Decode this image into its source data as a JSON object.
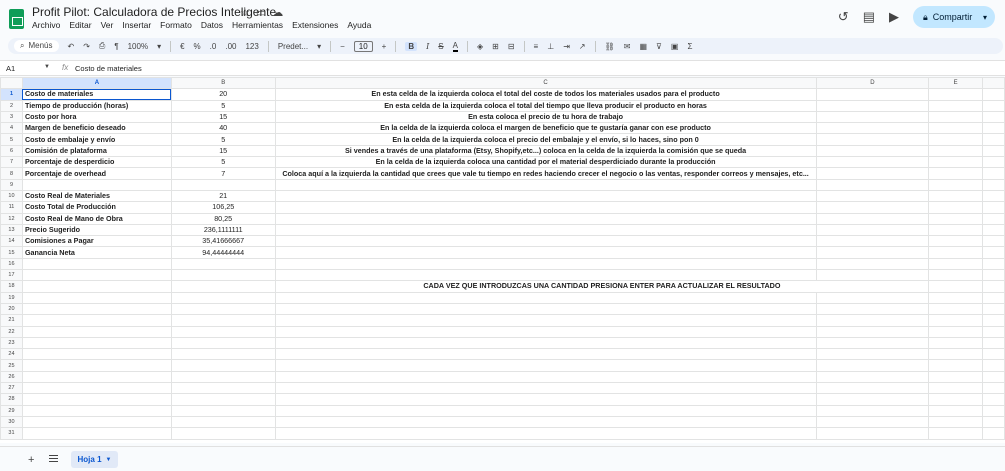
{
  "app": {
    "title": "Profit Pilot: Calculadora de Precios Inteligente",
    "share_label": "Compartir"
  },
  "menu": [
    "Archivo",
    "Editar",
    "Ver",
    "Insertar",
    "Formato",
    "Datos",
    "Herramientas",
    "Extensiones",
    "Ayuda"
  ],
  "toolbar": {
    "search_label": "Menús",
    "zoom": "100%",
    "currency": "€",
    "percent": "%",
    "dec_less": ".0",
    "dec_more": ".00",
    "number_format": "123",
    "font": "Predet...",
    "font_size": "10",
    "bold": "B",
    "italic": "I",
    "strike": "S",
    "text_color": "A",
    "sigma": "Σ"
  },
  "formula_bar": {
    "cell_ref": "A1",
    "fx": "fx",
    "content": "Costo de materiales"
  },
  "columns": [
    "A",
    "B",
    "C",
    "D",
    "E"
  ],
  "rows": [
    {
      "n": "1",
      "a": "Costo de materiales",
      "b": "20",
      "c": "En esta celda de la izquierda coloca el total del coste de todos los materiales usados para el producto"
    },
    {
      "n": "2",
      "a": "Tiempo de producción (horas)",
      "b": "5",
      "c": "En esta celda de la izquierda coloca el total del tiempo que lleva producir el producto en horas"
    },
    {
      "n": "3",
      "a": "Costo por hora",
      "b": "15",
      "c": "En esta coloca el precio de tu hora de trabajo"
    },
    {
      "n": "4",
      "a": "Margen de beneficio deseado",
      "b": "40",
      "c": "En la celda de la izquierda coloca el margen de beneficio que te gustaría ganar con ese producto"
    },
    {
      "n": "5",
      "a": "Costo de embalaje y envío",
      "b": "5",
      "c": "En la celda de la izquierda coloca el precio del embalaje y el envío, si lo haces, sino pon 0"
    },
    {
      "n": "6",
      "a": "Comisión de plataforma",
      "b": "15",
      "c": "Si vendes a través de una plataforma (Etsy, Shopify,etc...) coloca en la celda de la izquierda la comisión que se queda"
    },
    {
      "n": "7",
      "a": "Porcentaje de desperdicio",
      "b": "5",
      "c": "En la celda de la izquierda coloca una cantidad por el material desperdiciado durante la producción"
    },
    {
      "n": "8",
      "a": "Porcentaje de overhead",
      "b": "7",
      "c": "Coloca aquí a la izquierda la cantidad que crees que vale tu tiempo en redes haciendo crecer el negocio o las ventas, responder correos y mensajes, etc..."
    },
    {
      "n": "9",
      "a": "",
      "b": "",
      "c": ""
    },
    {
      "n": "10",
      "a": "Costo Real de Materiales",
      "b": "21",
      "c": ""
    },
    {
      "n": "11",
      "a": "Costo Total de Producción",
      "b": "106,25",
      "c": ""
    },
    {
      "n": "12",
      "a": "Costo Real de Mano de Obra",
      "b": "80,25",
      "c": ""
    },
    {
      "n": "13",
      "a": "Precio Sugerido",
      "b": "236,1111111",
      "c": ""
    },
    {
      "n": "14",
      "a": "Comisiones a Pagar",
      "b": "35,41666667",
      "c": ""
    },
    {
      "n": "15",
      "a": "Ganancia Neta",
      "b": "94,44444444",
      "c": ""
    }
  ],
  "empty_rows": [
    "16",
    "17",
    "19",
    "20",
    "21",
    "22",
    "23",
    "24",
    "25",
    "26",
    "27",
    "28",
    "29",
    "30",
    "31"
  ],
  "note_row": {
    "n": "18",
    "text": "CADA VEZ QUE INTRODUZCAS UNA CANTIDAD PRESIONA ENTER PARA ACTUALIZAR EL RESULTADO"
  },
  "sheet_tab": "Hoja 1"
}
